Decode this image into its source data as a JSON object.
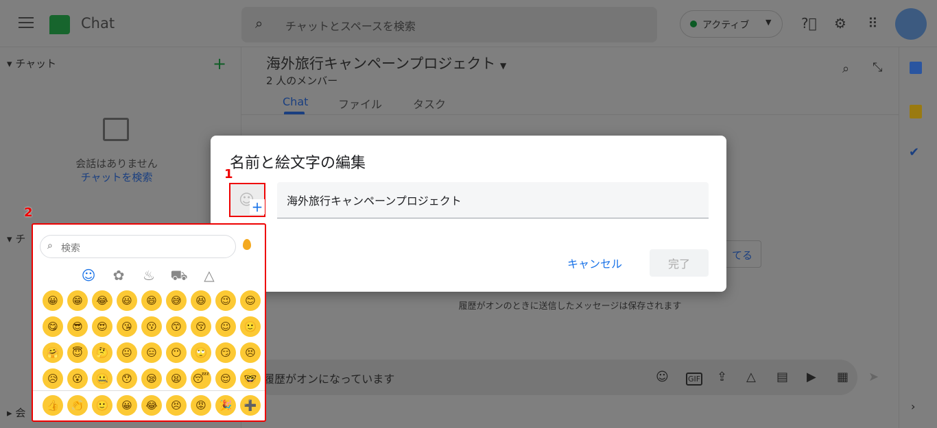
{
  "header": {
    "app_name": "Chat",
    "search_placeholder": "チャットとスペースを検索",
    "status": "アクティブ",
    "status_color": "#0c5a24"
  },
  "sidebar": {
    "chat_section": "チャット",
    "empty_text": "会話はありません",
    "empty_link": "チャットを検索",
    "spaces_section": "チ",
    "meet_section": "会"
  },
  "main": {
    "title": "海外旅行キャンペーンプロジェクト",
    "members": "2 人のメンバー",
    "tabs": [
      {
        "label": "Chat",
        "active": true
      },
      {
        "label": "ファイル"
      },
      {
        "label": "タスク"
      }
    ],
    "assign_button": "てる",
    "history_note": "履歴がオンのときに送信したメッセージは保存されます",
    "composer_placeholder": "履歴がオンになっています"
  },
  "dialog": {
    "title": "名前と絵文字の編集",
    "name_value": "海外旅行キャンペーンプロジェクト",
    "cancel": "キャンセル",
    "done": "完了",
    "marker": "1"
  },
  "picker": {
    "marker": "2",
    "search_placeholder": "検索",
    "categories": [
      "smileys",
      "nature",
      "food",
      "travel",
      "symbols"
    ],
    "emojis": [
      "😀",
      "😁",
      "😂",
      "😃",
      "😄",
      "😅",
      "😆",
      "😉",
      "😊",
      "😋",
      "😎",
      "😍",
      "😘",
      "😗",
      "😙",
      "😚",
      "☺",
      "🙂",
      "🤗",
      "😇",
      "🤔",
      "😐",
      "😑",
      "😶",
      "🙄",
      "😏",
      "😣",
      "😥",
      "😮",
      "🤐",
      "😯",
      "😪",
      "😫",
      "😴",
      "😌",
      "🤓"
    ],
    "recent": [
      "👍",
      "👏",
      "🙂",
      "😀",
      "😂",
      "😣",
      "😡",
      "🎉",
      "➕"
    ]
  }
}
